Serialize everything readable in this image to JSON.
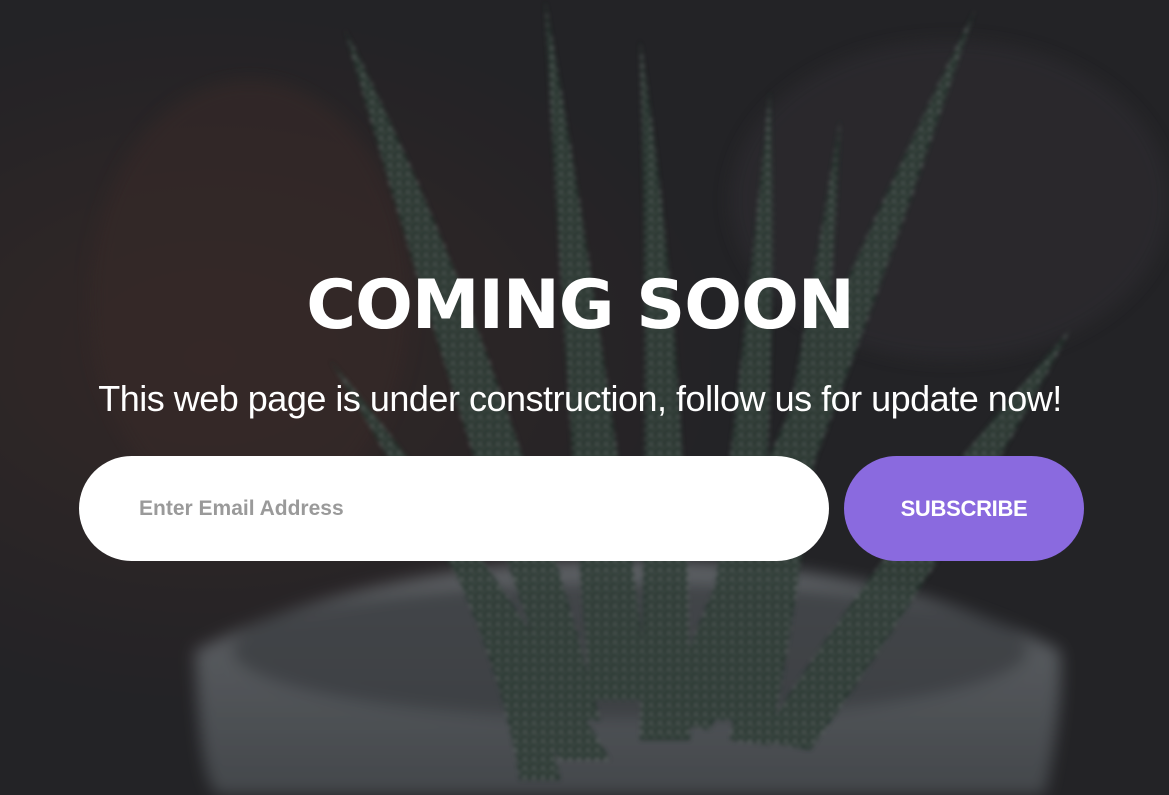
{
  "hero": {
    "title": "COMING SOON",
    "subtitle": "This web page is under construction, follow us for update now!"
  },
  "subscribe_form": {
    "email_placeholder": "Enter Email Address",
    "email_value": "",
    "button_label": "SUBSCRIBE"
  },
  "colors": {
    "accent": "#8a6adf",
    "title_text": "#ffffff",
    "input_background": "#ffffff",
    "placeholder_text": "#9a9a9a"
  },
  "background": {
    "subject": "blurred-aloe-plant-in-white-pot"
  }
}
